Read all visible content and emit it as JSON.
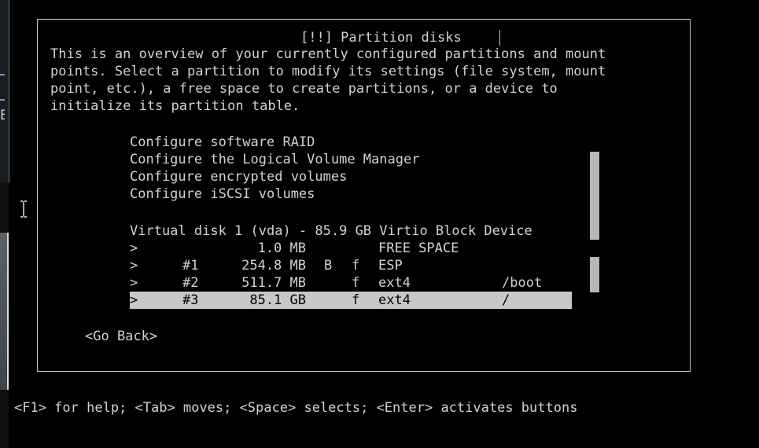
{
  "theme": {
    "background": "#000000",
    "foreground": "#d2d2d2",
    "highlight_bg": "#c8c8c8",
    "highlight_fg": "#000000"
  },
  "dialog": {
    "title": "[!!] Partition disks",
    "description": [
      "This is an overview of your currently configured partitions and mount",
      "points. Select a partition to modify its settings (file system, mount",
      "point, etc.), a free space to create partitions, or a device to",
      "initialize its partition table."
    ],
    "menu_items": [
      "Configure software RAID",
      "Configure the Logical Volume Manager",
      "Configure encrypted volumes",
      "Configure iSCSI volumes"
    ],
    "disk": {
      "label": "Virtual disk 1 (vda) - 85.9 GB Virtio Block Device",
      "rows": [
        {
          "marker": ">",
          "num": "",
          "size": "1.0 MB",
          "boot": "",
          "fmt": "",
          "fs": "FREE SPACE",
          "mount": "",
          "selected": false
        },
        {
          "marker": ">",
          "num": "#1",
          "size": "254.8 MB",
          "boot": "B",
          "fmt": "f",
          "fs": "ESP",
          "mount": "",
          "selected": false
        },
        {
          "marker": ">",
          "num": "#2",
          "size": "511.7 MB",
          "boot": "",
          "fmt": "f",
          "fs": "ext4",
          "mount": "/boot",
          "selected": false
        },
        {
          "marker": ">",
          "num": "#3",
          "size": "85.1 GB",
          "boot": "",
          "fmt": "f",
          "fs": "ext4",
          "mount": "/",
          "selected": true
        }
      ]
    },
    "go_back": "<Go Back>"
  },
  "help_line": "<F1> for help; <Tab> moves; <Space> selects; <Enter> activates buttons",
  "left_fragment": {
    "glyph": "E",
    "cursor_icon": "i-beam-cursor-icon"
  }
}
